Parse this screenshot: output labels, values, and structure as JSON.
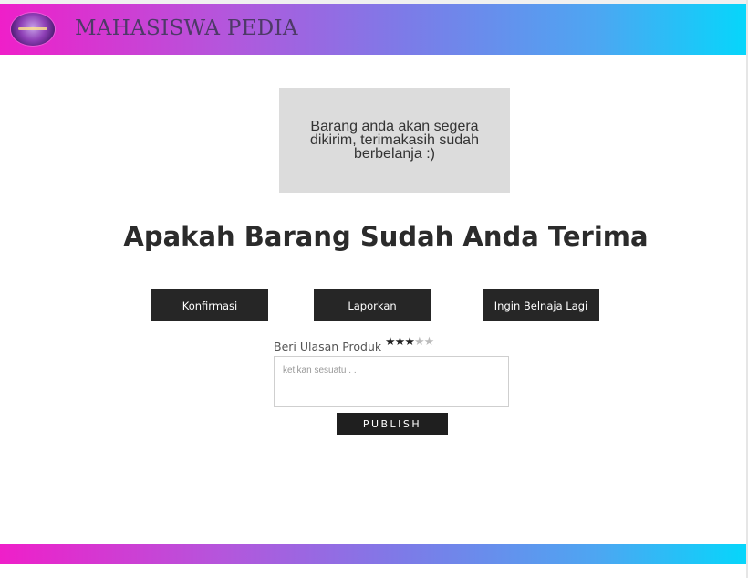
{
  "header": {
    "brand": "MAHASISWA PEDIA",
    "logo_icon": "brand-logo-icon",
    "gradient": [
      "#ef1fc9",
      "#06d6fb"
    ]
  },
  "notice": {
    "text": "Barang anda akan segera dikirim, terimakasih sudah berbelanja :)"
  },
  "question": {
    "title": "Apakah Barang Sudah Anda Terima"
  },
  "actions": {
    "confirm_label": "Konfirmasi",
    "report_label": "Laporkan",
    "shop_again_label": "Ingin Belnaja Lagi"
  },
  "review": {
    "label": "Beri Ulasan Produk",
    "rating": 3,
    "max_rating": 5,
    "star_icon": "star-icon",
    "placeholder": "ketikan sesuatu . .",
    "value": "",
    "publish_label": "PUBLISH"
  }
}
